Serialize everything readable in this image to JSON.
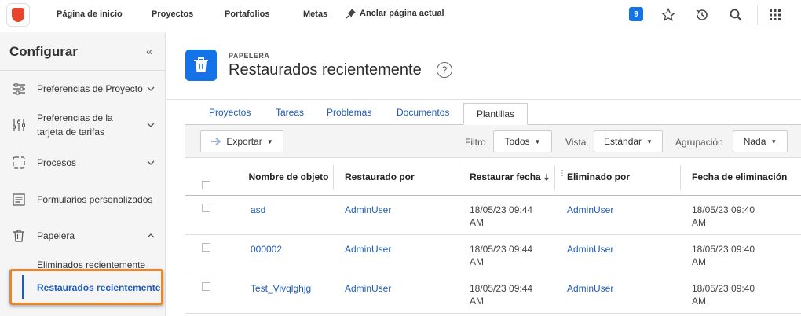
{
  "topbar": {
    "nav": [
      "Página de inicio",
      "Proyectos",
      "Portafolios",
      "Metas"
    ],
    "pin_label": "Anclar página actual",
    "badge_count": "9"
  },
  "sidebar": {
    "title": "Configurar",
    "items": [
      {
        "label": "Preferencias de Proyecto"
      },
      {
        "label": "Preferencias de la tarjeta de tarifas"
      },
      {
        "label": "Procesos"
      },
      {
        "label": "Formularios personalizados"
      },
      {
        "label": "Papelera"
      }
    ],
    "sub_items": [
      {
        "label": "Eliminados recientemente"
      },
      {
        "label": "Restaurados recientemente"
      }
    ]
  },
  "header": {
    "eyebrow": "PAPELERA",
    "title": "Restaurados recientemente",
    "help": "?"
  },
  "tabs": [
    "Proyectos",
    "Tareas",
    "Problemas",
    "Documentos",
    "Plantillas"
  ],
  "toolbar": {
    "export_label": "Exportar",
    "filter_label": "Filtro",
    "filter_value": "Todos",
    "view_label": "Vista",
    "view_value": "Estándar",
    "group_label": "Agrupación",
    "group_value": "Nada"
  },
  "table": {
    "columns": [
      "Nombre de objeto",
      "Restaurado por",
      "Restaurar fecha",
      "Eliminado por",
      "Fecha de eliminación"
    ],
    "rows": [
      {
        "name": "asd",
        "restored_by": "AdminUser",
        "restored_date": "18/05/23 09:44 AM",
        "deleted_by": "AdminUser",
        "deleted_date": "18/05/23 09:40 AM"
      },
      {
        "name": "000002",
        "restored_by": "AdminUser",
        "restored_date": "18/05/23 09:44 AM",
        "deleted_by": "AdminUser",
        "deleted_date": "18/05/23 09:40 AM"
      },
      {
        "name": "Test_Vivqlghjg",
        "restored_by": "AdminUser",
        "restored_date": "18/05/23 09:44 AM",
        "deleted_by": "AdminUser",
        "deleted_date": "18/05/23 09:40 AM"
      }
    ]
  },
  "colors": {
    "accent": "#1473e6",
    "link": "#1f5bb8",
    "highlight": "#e8862f",
    "logo": "#e8452c"
  }
}
